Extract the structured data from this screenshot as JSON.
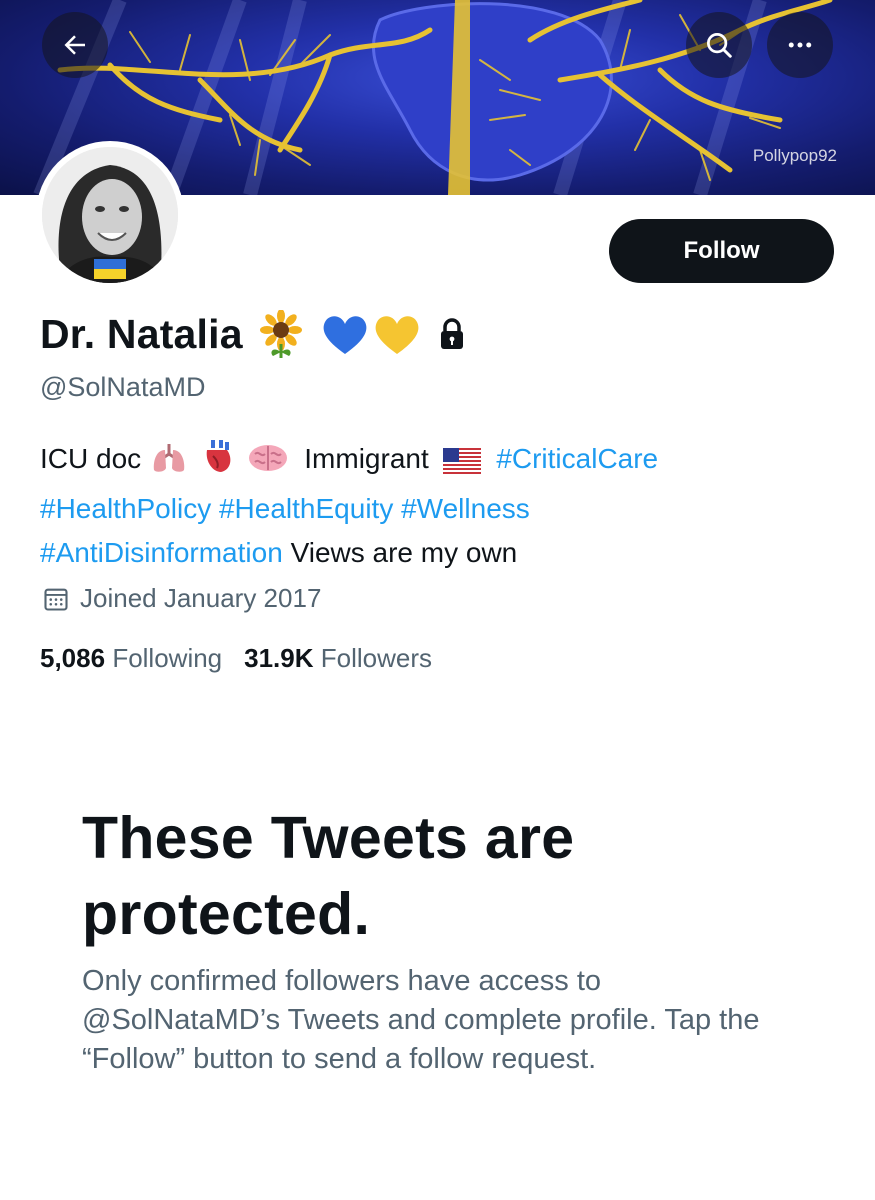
{
  "header": {
    "back_icon": "arrow-left-icon",
    "search_icon": "search-icon",
    "more_icon": "more-horizontal-icon",
    "banner_watermark": "Pollypop92",
    "banner_colors": {
      "bg": "#1f2aa0",
      "veins": "#e6c233"
    }
  },
  "profile": {
    "name": "Dr. Natalia",
    "name_emojis": [
      "sunflower",
      "blue-heart",
      "yellow-heart"
    ],
    "lock_icon": "lock-icon",
    "handle": "@SolNataMD",
    "follow_label": "Follow",
    "bio": {
      "part1": "ICU doc",
      "emojis1": [
        "lungs",
        "anatomical-heart",
        "brain"
      ],
      "part2": "Immigrant",
      "flag": "us-flag",
      "tags_line1": [
        "#CriticalCare"
      ],
      "tags_line2": [
        "#HealthPolicy",
        "#HealthEquity",
        "#Wellness"
      ],
      "tag_line3": "#AntiDisinformation",
      "tail": "Views are my own"
    },
    "joined": "Joined January 2017",
    "following_count": "5,086",
    "following_label": "Following",
    "followers_count": "31.9K",
    "followers_label": "Followers"
  },
  "protected": {
    "title": "These Tweets are protected.",
    "body": "Only confirmed followers have access to @SolNataMD’s Tweets and complete profile. Tap the “Follow” button to send a follow request."
  },
  "colors": {
    "link": "#1d9bf0",
    "text": "#0f1419",
    "muted": "#536471"
  }
}
